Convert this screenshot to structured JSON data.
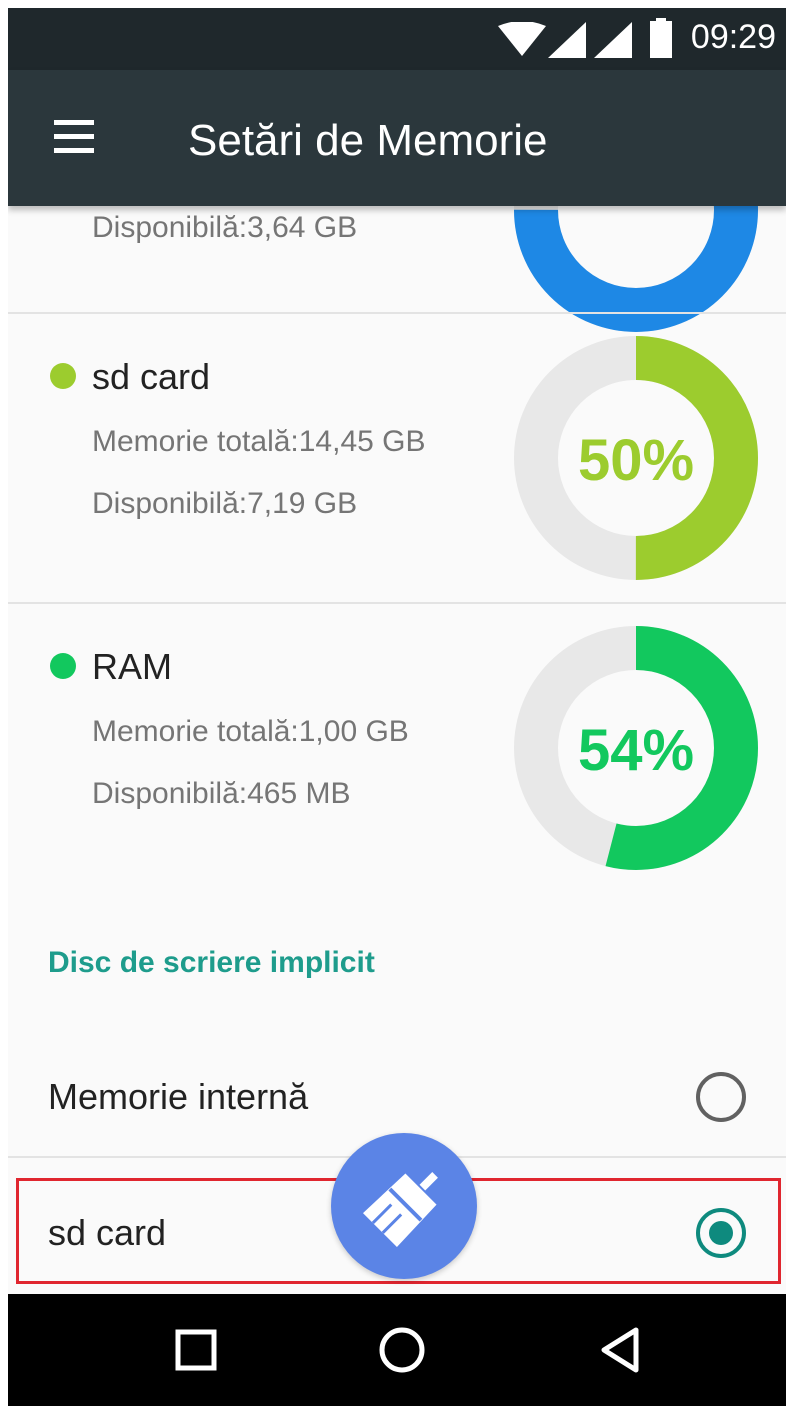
{
  "status_bar": {
    "time": "09:29",
    "icons": [
      "wifi-icon",
      "signal-icon",
      "signal-icon",
      "battery-icon"
    ]
  },
  "app_bar": {
    "menu_icon": "menu-icon",
    "title": "Setări de Memorie"
  },
  "storage": {
    "internal": {
      "available": "Disponibilă:3,64 GB",
      "color": "#1e88e5",
      "used_fraction": 0.75
    },
    "sd_card": {
      "name": "sd card",
      "total": "Memorie totală:14,45 GB",
      "available": "Disponibilă:7,19 GB",
      "percent": "50%",
      "used_fraction": 0.5,
      "color": "#9ccc2e"
    },
    "ram": {
      "name": "RAM",
      "total": "Memorie totală:1,00 GB",
      "available": "Disponibilă:465 MB",
      "percent": "54%",
      "used_fraction": 0.54,
      "color": "#12c85e"
    },
    "track_color": "#e8e8e8"
  },
  "default_write_disk": {
    "header": "Disc de scriere implicit",
    "options": [
      {
        "label": "Memorie internă",
        "selected": false
      },
      {
        "label": "sd card",
        "selected": true
      }
    ]
  },
  "fab": {
    "icon": "broom-icon",
    "color": "#5b84e6"
  },
  "nav_bar": {
    "buttons": [
      "recents-square-icon",
      "home-circle-icon",
      "back-triangle-icon"
    ]
  }
}
